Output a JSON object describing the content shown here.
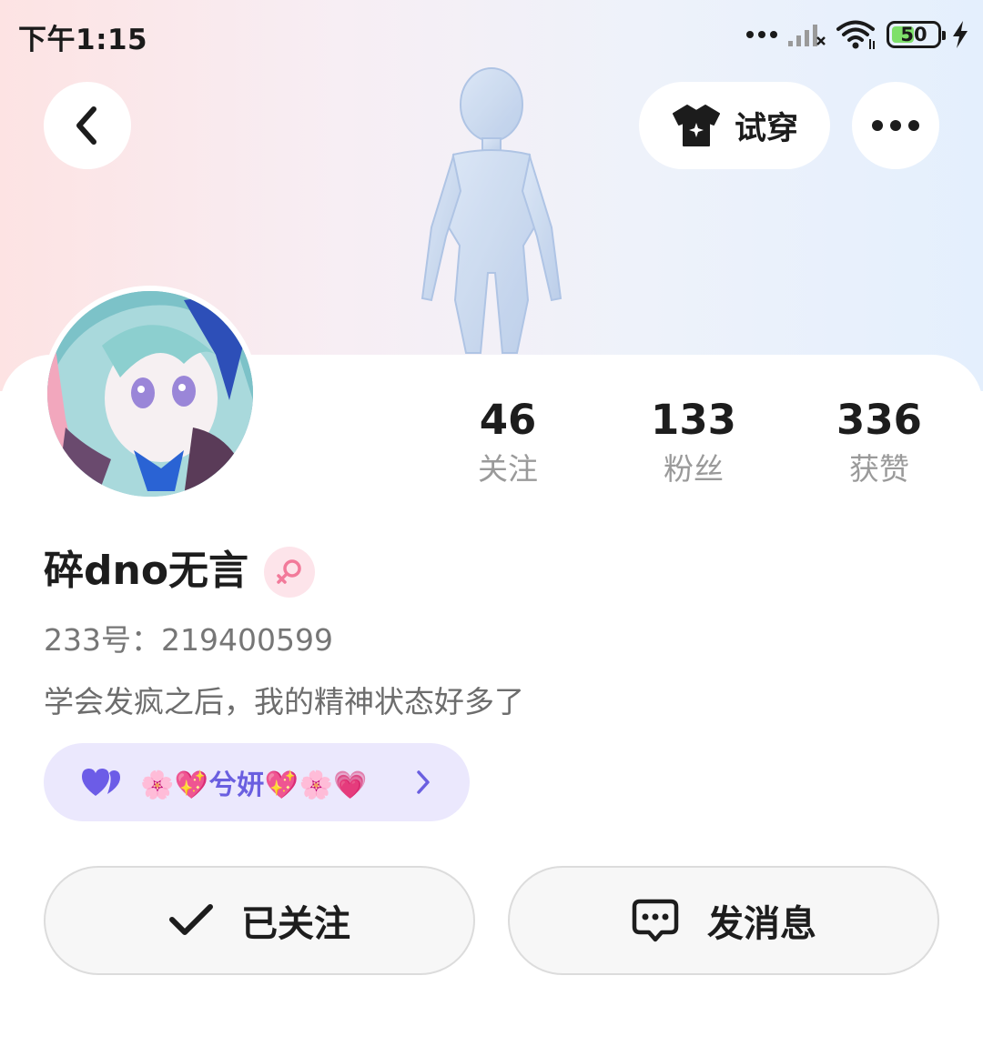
{
  "status_bar": {
    "time": "下午1:15",
    "battery": "50",
    "battery_level": 0.5
  },
  "header": {
    "back_icon": "chevron-left-icon",
    "tryon_label": "试穿",
    "tryon_icon": "tshirt-icon",
    "more_icon": "more-dots-icon"
  },
  "profile": {
    "name": "碎dno无言",
    "gender_icon": "female-icon",
    "uid": "233号：219400599",
    "bio": "学会发疯之后，我的精神状态好多了"
  },
  "stats": [
    {
      "value": "46",
      "label": "关注"
    },
    {
      "value": "133",
      "label": "粉丝"
    },
    {
      "value": "336",
      "label": "获赞"
    }
  ],
  "tag": {
    "text": "🌸💖兮妍💖🌸💗",
    "icon": "double-heart-icon"
  },
  "actions": {
    "follow_label": "已关注",
    "message_label": "发消息"
  },
  "colors": {
    "accent": "#6a5fe0",
    "tag_bg": "#ebe8fd",
    "gender_pink": "#f27a9a"
  }
}
